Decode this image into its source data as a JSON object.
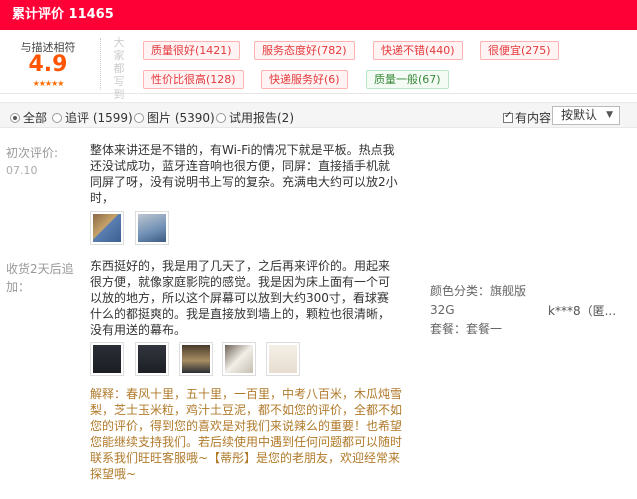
{
  "header": {
    "title": "累计评价",
    "count": "11465"
  },
  "rating": {
    "label": "与描述相符",
    "score": "4.9",
    "stars": "★★★★★"
  },
  "impression_label": "大家都写到",
  "tags": [
    {
      "text": "质量很好(1421)",
      "type": "positive"
    },
    {
      "text": "服务态度好(782)",
      "type": "positive"
    },
    {
      "text": "快递不错(440)",
      "type": "positive"
    },
    {
      "text": "很便宜(275)",
      "type": "positive"
    },
    {
      "text": "性价比很高(128)",
      "type": "positive"
    },
    {
      "text": "快递服务好(6)",
      "type": "positive"
    },
    {
      "text": "质量一般(67)",
      "type": "negative"
    }
  ],
  "filters": {
    "options": [
      "全部",
      "追评 (1599)",
      "图片 (5390)",
      "试用报告(2)"
    ],
    "selected": "全部",
    "has_content_label": "有内容",
    "sort_label": "按默认"
  },
  "review": {
    "first_label": "初次评价:",
    "first_date": "07.10",
    "first_text": "整体来讲还是不错的，有Wi-Fi的情况下就是平板。热点我还没试成功，蓝牙连音响也很方便，同屏：直接插手机就同屏了呀，没有说明书上写的复杂。充满电大约可以放2小时，",
    "followup_label": "收货2天后追加：",
    "followup_text": "东西挺好的，我是用了几天了，之后再来评价的。用起来很方便，就像家庭影院的感觉。我是因为床上面有一个可以放的地方，所以这个屏幕可以放到大约300寸，看球赛什么的都挺爽的。我是直接放到墙上的，颗粒也很清晰，没有用送的幕布。",
    "reply_text": "解释：春风十里，五十里，一百里，中考八百米，木瓜炖雪梨，芝士玉米粒，鸡汁土豆泥，都不如您的评价，全都不如您的评价，得到您的喜欢是对我们来说辣么的重要！也希望您能继续支持我们。若后续使用中遇到任何问题都可以随时联系我们旺旺客服哦~【蒂彤】是您的老朋友，欢迎经常来探望哦~",
    "sku_color": "颜色分类：旗舰版",
    "sku_size": "32G",
    "sku_set": "套餐：套餐一",
    "user": "k***8（匿..."
  }
}
